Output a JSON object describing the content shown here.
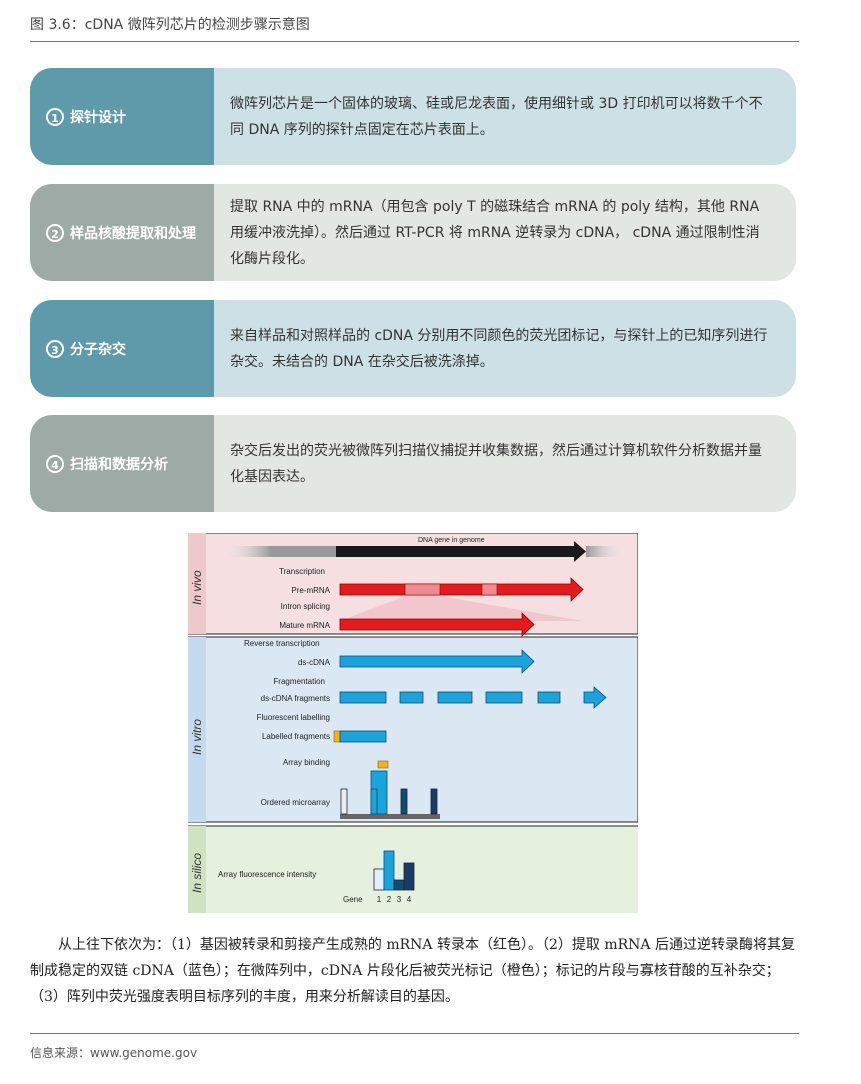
{
  "header": {
    "title": "图 3.6：cDNA 微阵列芯片的检测步骤示意图"
  },
  "steps": [
    {
      "num": "1",
      "label": "探针设计",
      "desc": "微阵列芯片是一个固体的玻璃、硅或尼龙表面，使用细针或 3D 打印机可以将数千个不同 DNA 序列的探针点固定在芯片表面上。"
    },
    {
      "num": "2",
      "label": "样品核酸提取和处理",
      "desc": "提取 RNA 中的 mRNA（用包含 poly T 的磁珠结合 mRNA 的 poly 结构，其他 RNA 用缓冲液洗掉）。然后通过 RT-PCR 将 mRNA 逆转录为 cDNA， cDNA 通过限制性消化酶片段化。"
    },
    {
      "num": "3",
      "label": "分子杂交",
      "desc": "来自样品和对照样品的 cDNA 分别用不同颜色的荧光团标记，与探针上的已知序列进行杂交。未结合的 DNA 在杂交后被洗涤掉。"
    },
    {
      "num": "4",
      "label": "扫描和数据分析",
      "desc": "杂交后发出的荧光被微阵列扫描仪捕捉并收集数据，然后通过计算机软件分析数据并量化基因表达。"
    }
  ],
  "figure": {
    "sections": {
      "in_vivo": "In vivo",
      "in_vitro": "In vitro",
      "in_silico": "In silico"
    },
    "labels": {
      "dna_gene": "DNA gene in genome",
      "transcription": "Transcription",
      "pre_mrna": "Pre-mRNA",
      "intron_splicing": "Intron splicing",
      "mature_mrna": "Mature mRNA",
      "reverse_transcription": "Reverse transcription",
      "ds_cdna": "ds-cDNA",
      "fragmentation": "Fragmentation",
      "ds_cdna_fragments": "ds-cDNA fragments",
      "fluorescent_labelling": "Fluorescent labelling",
      "labelled_fragments": "Labelled fragments",
      "array_binding": "Array binding",
      "ordered_microarray": "Ordered microarray",
      "array_intensity": "Array fluorescence intensity",
      "gene": "Gene",
      "gene_numbers": [
        "1",
        "2",
        "3",
        "4"
      ]
    },
    "colors": {
      "vivo_bg": "#f5dfe0",
      "vitro_bg": "#dbe8f4",
      "silico_bg": "#e6f0de",
      "vivo_side": "#eec8ca",
      "vitro_side": "#c5daee",
      "silico_side": "#cfe3c2",
      "dna": "#1a1a1a",
      "mrna": "#e21c1c",
      "cdna": "#1aa3dc",
      "label": "#f1b315"
    }
  },
  "caption": "从上往下依次为：（1）基因被转录和剪接产生成熟的 mRNA 转录本（红色）。（2）提取 mRNA 后通过逆转录酶将其复制成稳定的双链 cDNA（蓝色）；在微阵列中，cDNA 片段化后被荧光标记（橙色）；标记的片段与寡核苷酸的互补杂交；（3）阵列中荧光强度表明目标序列的丰度，用来分析解读目的基因。",
  "source": "信息来源：www.genome.gov"
}
